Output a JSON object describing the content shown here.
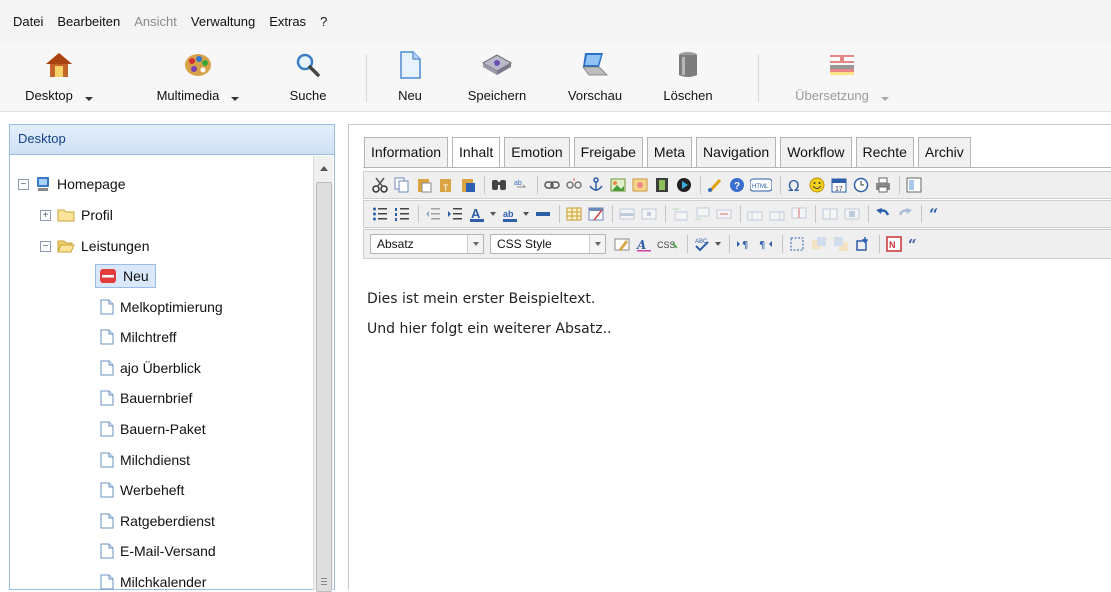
{
  "menubar": [
    {
      "label": "Datei",
      "disabled": false
    },
    {
      "label": "Bearbeiten",
      "disabled": false
    },
    {
      "label": "Ansicht",
      "disabled": true
    },
    {
      "label": "Verwaltung",
      "disabled": false
    },
    {
      "label": "Extras",
      "disabled": false
    },
    {
      "label": "?",
      "disabled": false
    }
  ],
  "toolbar": {
    "desktop": "Desktop",
    "multimedia": "Multimedia",
    "suche": "Suche",
    "neu": "Neu",
    "speichern": "Speichern",
    "vorschau": "Vorschau",
    "loeschen": "Löschen",
    "uebersetzung": "Übersetzung"
  },
  "sidebar": {
    "title": "Desktop",
    "tree": {
      "homepage": "Homepage",
      "profil": "Profil",
      "leistungen": "Leistungen",
      "neu": "Neu",
      "pages": [
        "Melkoptimierung",
        "Milchtreff",
        "ajo Überblick",
        "Bauernbrief",
        "Bauern-Paket",
        "Milchdienst",
        "Werbeheft",
        "Ratgeberdienst",
        "E-Mail-Versand",
        "Milchkalender"
      ]
    }
  },
  "tabs": [
    "Information",
    "Inhalt",
    "Emotion",
    "Freigabe",
    "Meta",
    "Navigation",
    "Workflow",
    "Rechte",
    "Archiv"
  ],
  "active_tab": "Inhalt",
  "editor": {
    "format_select": "Absatz",
    "style_select": "CSS Style",
    "paragraphs": [
      "Dies ist mein erster Beispieltext.",
      "Und hier folgt ein weiterer Absatz.."
    ]
  },
  "icons": {
    "toolbar": [
      "home-icon",
      "palette-icon",
      "magnifier-icon",
      "new-page-icon",
      "save-icon",
      "preview-icon",
      "trash-icon",
      "translate-icon"
    ],
    "row1": [
      "cut-icon",
      "copy-icon",
      "paste-icon",
      "paste-text-icon",
      "paste-word-icon",
      "find-icon",
      "replace-icon",
      "link-icon",
      "unlink-icon",
      "anchor-icon",
      "image-icon",
      "flash-icon",
      "media-icon",
      "flash-play-icon",
      "clean-icon",
      "help-icon",
      "html-icon",
      "omega-icon",
      "smiley-icon",
      "date-icon",
      "time-icon",
      "print-icon",
      "template-icon"
    ],
    "row2": [
      "bullet-list-icon",
      "numbered-list-icon",
      "outdent-icon",
      "indent-icon",
      "text-color-icon",
      "highlight-color-icon",
      "horizontal-rule-icon",
      "table-icon",
      "table-props-icon",
      "row-props-icon",
      "cell-props-icon",
      "insert-row-before-icon",
      "insert-row-after-icon",
      "delete-row-icon",
      "insert-col-before-icon",
      "insert-col-after-icon",
      "delete-col-icon",
      "split-cells-icon",
      "merge-cells-icon",
      "undo-icon",
      "redo-icon",
      "blockquote-icon"
    ],
    "row3": [
      "edit-css-icon",
      "styleprops-icon",
      "css-icon",
      "spellcheck-icon",
      "ltr-icon",
      "rtl-icon",
      "visual-aid-icon",
      "layer-insert-icon",
      "layer-move-icon",
      "absolute-icon",
      "nonbreaking-icon",
      "cite-icon"
    ]
  }
}
